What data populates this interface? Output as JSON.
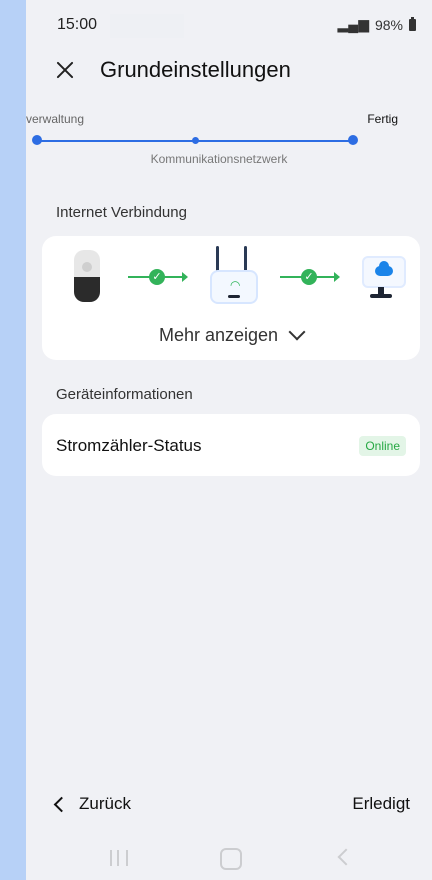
{
  "status": {
    "time": "15:00",
    "battery": "98%"
  },
  "header": {
    "title": "Grundeinstellungen"
  },
  "stepper": {
    "left_label": "verwaltung",
    "right_label": "Fertig",
    "middle_label": "Kommunikationsnetzwerk"
  },
  "connection": {
    "section_title": "Internet Verbindung",
    "more_label": "Mehr anzeigen",
    "check_symbol": "✓"
  },
  "device_info": {
    "section_title": "Geräteinformationen",
    "meter_status_label": "Stromzähler-Status",
    "meter_status_badge": "Online"
  },
  "footer": {
    "back_label": "Zurück",
    "done_label": "Erledigt"
  },
  "icons": {
    "close": "close-icon",
    "meter": "meter-icon",
    "router": "router-icon",
    "cloud": "cloud-icon",
    "chevron_down": "chevron-down-icon",
    "chevron_left": "chevron-left-icon"
  },
  "colors": {
    "accent": "#2d6de3",
    "success": "#33b35a",
    "background": "#f0f1f5"
  }
}
